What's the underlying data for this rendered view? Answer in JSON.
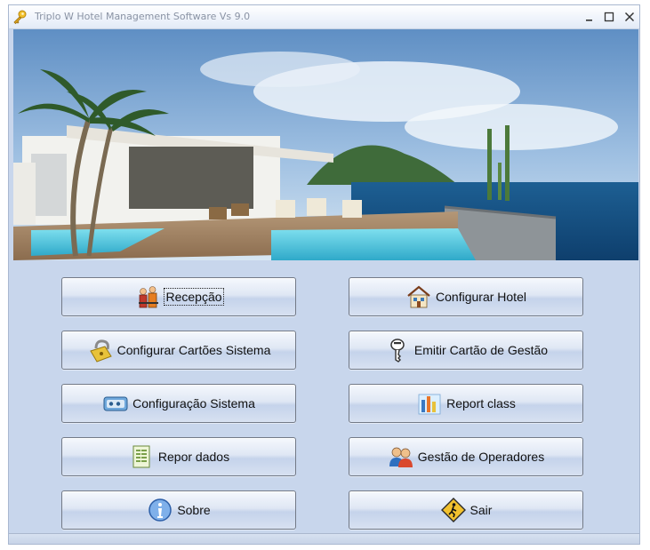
{
  "window": {
    "title": "Triplo W Hotel Management Software Vs 9.0",
    "controls": {
      "minimize": "minimize-icon",
      "maximize": "maximize-icon",
      "close": "close-icon"
    }
  },
  "hero": {
    "description_icon": "hotel-pool-photo"
  },
  "buttons": {
    "rececao": {
      "label": "Recepção",
      "icon": "reception-icon"
    },
    "configurar_hotel": {
      "label": "Configurar Hotel",
      "icon": "hotel-house-icon"
    },
    "configurar_cartoes": {
      "label": "Configurar Cartões Sistema",
      "icon": "padlock-icon"
    },
    "emitir_cartao": {
      "label": "Emitir Cartão de Gestão",
      "icon": "key-icon"
    },
    "configuracao_sistema": {
      "label": "Configuração Sistema",
      "icon": "system-device-icon"
    },
    "report_class": {
      "label": "Report class",
      "icon": "bar-chart-icon"
    },
    "repor_dados": {
      "label": "Repor dados",
      "icon": "data-sheet-icon"
    },
    "gestao_operadores": {
      "label": "Gestão de Operadores",
      "icon": "operators-icon"
    },
    "sobre": {
      "label": "Sobre",
      "icon": "info-icon"
    },
    "sair": {
      "label": "Sair",
      "icon": "exit-sign-icon"
    }
  },
  "colors": {
    "window_bg": "#c8d6ec",
    "button_border": "#737a87"
  }
}
